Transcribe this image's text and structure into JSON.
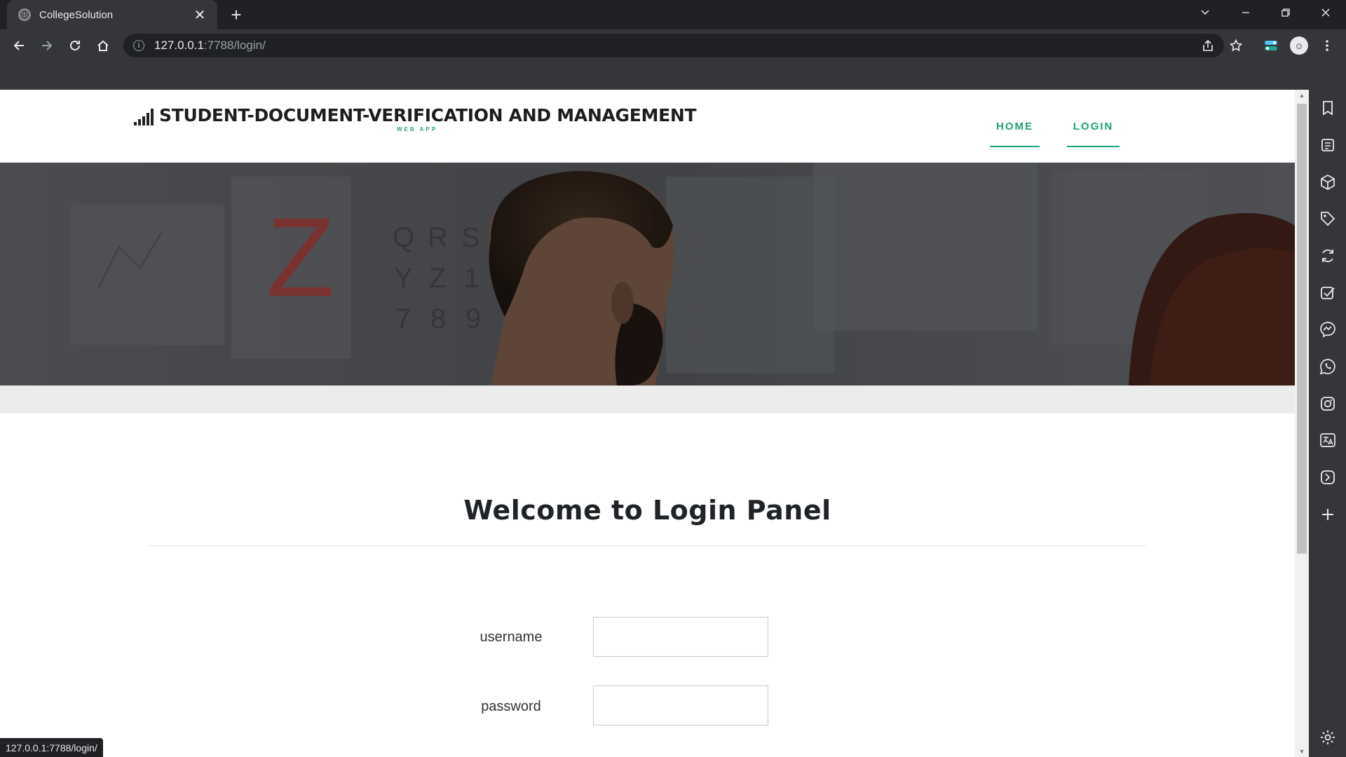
{
  "browser": {
    "tab_title": "CollegeSolution",
    "url_host": "127.0.0.1",
    "url_path": ":7788/login/",
    "status_url": "127.0.0.1:7788/login/"
  },
  "site": {
    "logo_text": "STUDENT-DOCUMENT-VERIFICATION AND MANAGEMENT",
    "logo_sub": "WEB APP",
    "nav": [
      {
        "label": "HOME"
      },
      {
        "label": "LOGIN"
      }
    ]
  },
  "login": {
    "heading": "Welcome to Login Panel",
    "username_label": "username",
    "password_label": "password",
    "username_value": "",
    "password_value": ""
  },
  "hero": {
    "chart_glyphs": [
      "Z",
      "Q",
      "R",
      "S",
      "Y",
      "Z",
      "1",
      "7",
      "8",
      "9"
    ]
  },
  "colors": {
    "accent": "#1ea26f",
    "chrome_dark": "#202124",
    "chrome": "#35363a"
  }
}
